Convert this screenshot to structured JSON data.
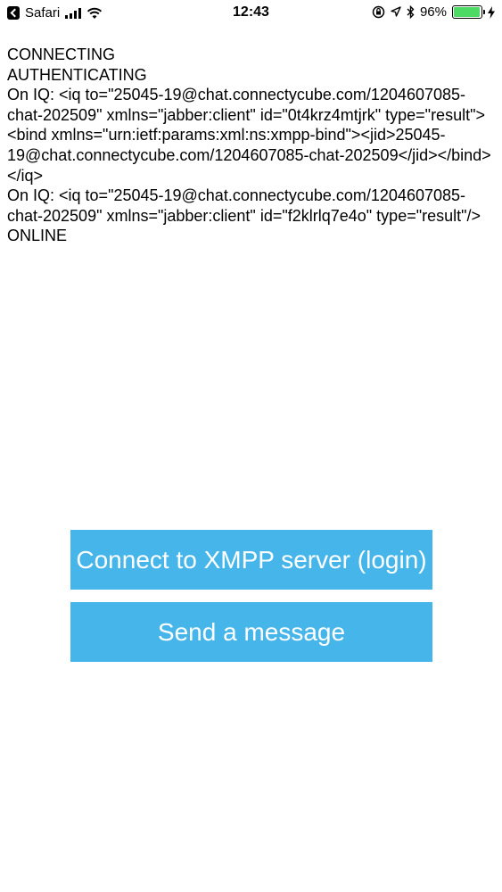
{
  "status_bar": {
    "back_app": "Safari",
    "time": "12:43",
    "battery_percent_label": "96%",
    "battery_level": 0.96,
    "icons": [
      "back-icon",
      "signal-icon",
      "wifi-icon",
      "orientation-lock-icon",
      "location-icon",
      "bluetooth-icon",
      "battery-icon",
      "charging-icon"
    ]
  },
  "log": {
    "lines": [
      "CONNECTING",
      "AUTHENTICATING",
      "On IQ: <iq to=\"25045-19@chat.connectycube.com/1204607085-chat-202509\" xmlns=\"jabber:client\" id=\"0t4krz4mtjrk\" type=\"result\"><bind xmlns=\"urn:ietf:params:xml:ns:xmpp-bind\"><jid>25045-19@chat.connectycube.com/1204607085-chat-202509</jid></bind></iq>",
      "On IQ: <iq to=\"25045-19@chat.connectycube.com/1204607085-chat-202509\" xmlns=\"jabber:client\" id=\"f2klrlq7e4o\" type=\"result\"/>",
      "ONLINE"
    ]
  },
  "buttons": {
    "connect_label": "Connect to XMPP server (login)",
    "send_label": "Send a message",
    "color": "#46b5ea"
  }
}
